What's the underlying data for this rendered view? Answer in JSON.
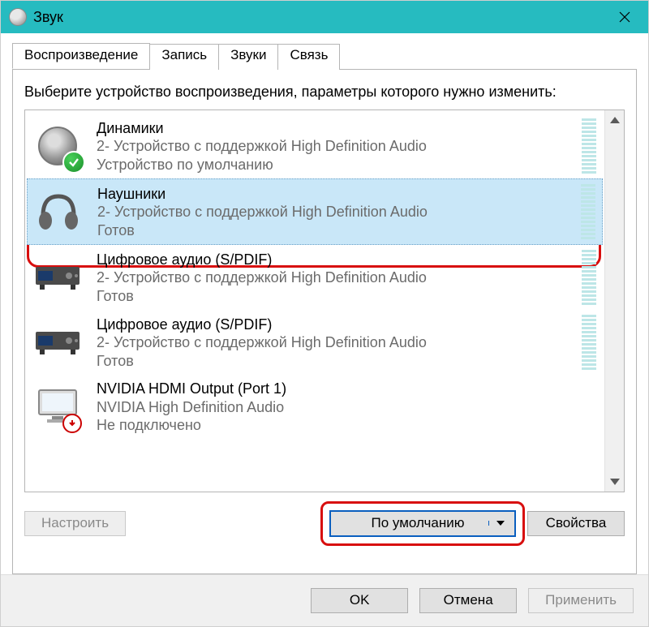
{
  "title": "Звук",
  "tabs": [
    "Воспроизведение",
    "Запись",
    "Звуки",
    "Связь"
  ],
  "active_tab": 0,
  "instruction": "Выберите устройство воспроизведения, параметры которого нужно изменить:",
  "devices": [
    {
      "name": "Динамики",
      "subtitle": "2- Устройство с поддержкой High Definition Audio",
      "status": "Устройство по умолчанию",
      "icon": "speaker",
      "default": true,
      "selected": false,
      "meter": true
    },
    {
      "name": "Наушники",
      "subtitle": "2- Устройство с поддержкой High Definition Audio",
      "status": "Готов",
      "icon": "headphones",
      "default": false,
      "selected": true,
      "meter": true
    },
    {
      "name": "Цифровое аудио (S/PDIF)",
      "subtitle": "2- Устройство с поддержкой High Definition Audio",
      "status": "Готов",
      "icon": "receiver",
      "default": false,
      "selected": false,
      "meter": true
    },
    {
      "name": "Цифровое аудио (S/PDIF)",
      "subtitle": "2- Устройство с поддержкой High Definition Audio",
      "status": "Готов",
      "icon": "receiver",
      "default": false,
      "selected": false,
      "meter": true
    },
    {
      "name": "NVIDIA HDMI Output (Port 1)",
      "subtitle": "NVIDIA High Definition Audio",
      "status": "Не подключено",
      "icon": "monitor",
      "default": false,
      "selected": false,
      "meter": false,
      "error": true
    }
  ],
  "buttons": {
    "configure": "Настроить",
    "set_default": "По умолчанию",
    "properties": "Свойства",
    "ok": "OK",
    "cancel": "Отмена",
    "apply": "Применить"
  }
}
